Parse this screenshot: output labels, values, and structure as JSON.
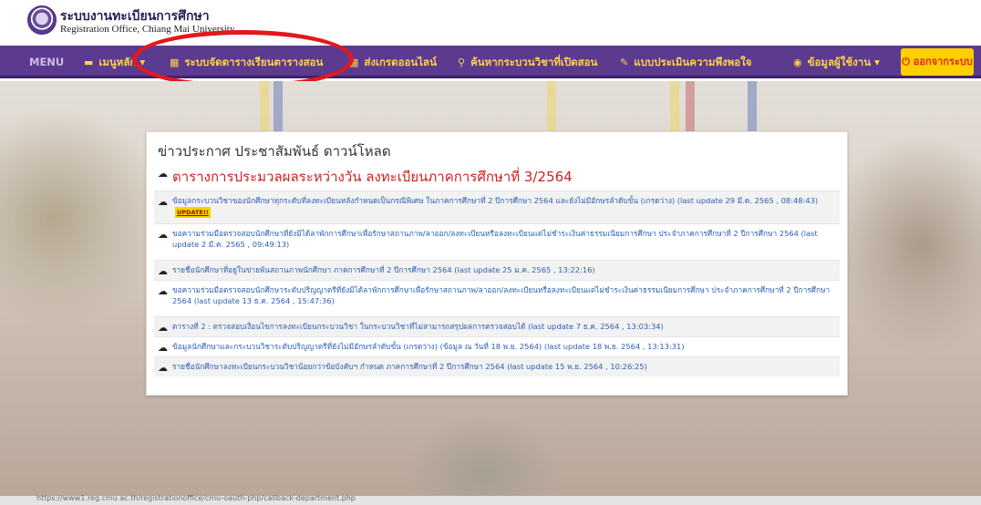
{
  "header": {
    "title": "ระบบงานทะเบียนการศึกษา",
    "subtitle": "Registration Office, Chiang Mai University"
  },
  "nav": {
    "menu_label": "MENU",
    "items": [
      {
        "icon": "folder-open-icon",
        "label": "เมนูหลัก"
      },
      {
        "icon": "calendar-icon",
        "label": "ระบบจัดตารางเรียนตารางสอน"
      },
      {
        "icon": "calendar-icon",
        "label": "ส่งเกรดออนไลน์"
      },
      {
        "icon": "search-icon",
        "label": "ค้นหากระบวนวิชาที่เปิดสอน"
      },
      {
        "icon": "pencil-icon",
        "label": "แบบประเมินความพึงพอใจ"
      },
      {
        "icon": "user-icon",
        "label": "ข้อมูลผู้ใช้งาน"
      }
    ],
    "logout_label": "ออกจากระบบ"
  },
  "colors": {
    "navbar": "#5b3a8f",
    "nav_text": "#ffd34a",
    "logout_bg": "#ffd000",
    "annotation_oval": "#e3181d",
    "headline": "#d12020",
    "link": "#2a5fb3"
  },
  "panel": {
    "title": "ข่าวประกาศ ประชาสัมพันธ์ ดาวน์โหลด",
    "headline": "ตารางการประมวลผลระหว่างวัน ลงทะเบียนภาคการศึกษาที่ 3/2564",
    "update_badge": "UPDATE!!",
    "items": [
      "ข้อมูลกระบวนวิชาของนักศึกษาทุกระดับที่ลงทะเบียนหลังกำหนดเป็นกรณีพิเศษ ในภาคการศึกษาที่ 2 ปีการศึกษา 2564 และยังไม่มีอักษรลำดับขั้น (เกรดว่าง) (last update 29 มี.ค. 2565 , 08:48:43)",
      "ขอความร่วมมือตรวจสอบนักศึกษาที่ยังมิได้ลาพักการศึกษาเพื่อรักษาสถานภาพ/ลาออก/ลงทะเบียนหรือลงทะเบียนแต่ไม่ชำระเงินค่าธรรมเนียมการศึกษา ประจำภาคการศึกษาที่ 2 ปีการศึกษา 2564 (last update 2 มี.ค. 2565 , 09:49:13)",
      "รายชื่อนักศึกษาที่อยู่ในข่ายพ้นสถานภาพนักศึกษา ภาคการศึกษาที่ 2 ปีการศึกษา 2564 (last update 25 ม.ค. 2565 , 13:22:16)",
      "ขอความร่วมมือตรวจสอบนักศึกษาระดับปริญญาตรีที่ยังมิได้ลาพักการศึกษาเพื่อรักษาสถานภาพ/ลาออก/ลงทะเบียนหรือลงทะเบียนแต่ไม่ชำระเงินค่าธรรมเนียมการศึกษา ประจำภาคการศึกษาที่ 2 ปีการศึกษา 2564 (last update 13 ธ.ค. 2564 , 15:47:36)",
      "ตารางที่ 2 : ตรวจสอบเงื่อนไขการลงทะเบียนกระบวนวิชา ในกระบวนวิชาที่ไม่สามารถสรุปผลการตรวจสอบได้ (last update 7 ธ.ค. 2564 , 13:03:34)",
      "ข้อมูลนักศึกษาและกระบวนวิชาระดับปริญญาตรีที่ยังไม่มีอักษรลำดับขั้น (เกรดว่าง) (ข้อมูล ณ วันที่ 18 พ.ย. 2564) (last update 18 พ.ย. 2564 , 13:13:31)",
      "รายชื่อนักศึกษาลงทะเบียนกระบวนวิชาน้อยกว่าข้อบังคับฯ กำหนด ภาคการศึกษาที่ 2 ปีการศึกษา 2564 (last update 15 พ.ย. 2564 , 10:26:25)"
    ]
  },
  "status_bar": {
    "url": "https://www1.reg.cmu.ac.th/registrationoffice/cmu-oauth-php/callback-department.php"
  }
}
